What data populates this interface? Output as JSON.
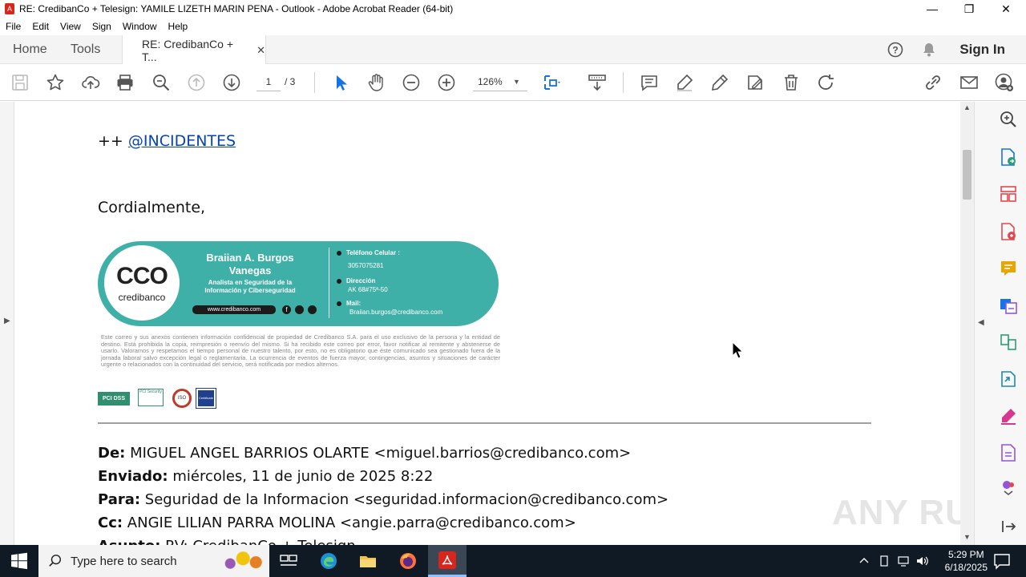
{
  "window": {
    "title": "RE: CredibanCo + Telesign: YAMILE LIZETH MARIN PENA - Outlook - Adobe Acrobat Reader (64-bit)",
    "minimize": "—",
    "maximize": "❐",
    "close": "✕"
  },
  "menu": [
    "File",
    "Edit",
    "View",
    "Sign",
    "Window",
    "Help"
  ],
  "tabs": {
    "home": "Home",
    "tools": "Tools",
    "document": "RE: CredibanCo + T...",
    "close": "✕",
    "sign_in": "Sign In"
  },
  "toolbar": {
    "page_current": "1",
    "page_total": "/ 3",
    "zoom": "126%"
  },
  "email": {
    "mention_prefix": "++",
    "mention": "@INCIDENTES",
    "closing": "Cordialmente,",
    "signature": {
      "logo": "CCO",
      "logo_sub": "credibanco",
      "name_line1": "Braiian A. Burgos",
      "name_line2": "Vanegas",
      "role_line1": "Analista en Seguridad de la",
      "role_line2": "Información y Ciberseguridad",
      "website": "www.credibanco.com",
      "phone_label": "Teléfono Celular :",
      "phone": "3057075281",
      "address_label": "Dirección",
      "address": "AK 68#75ª-50",
      "mail_label": "Mail:",
      "mail": "Braiian.burgos@credibanco.com",
      "disclaimer": "Este correo y sus anexos contienen información confidencial de propiedad de Credibanco S.A. para el uso exclusivo de la persona y la entidad de destino. Está prohibida la copia, reimpresión o reenvío del mismo. Si ha recibido este correo por error, favor notificar al remitente y abstenerse de usarlo. Valoramos y respetamos el tiempo personal de nuestro talento, por esto, no es obligatorio que éste comunicado sea gestionado fuera de la jornada laboral salvo excepción legal o reglamentaria. La ocurrencia de eventos de fuerza mayor, contingencias, asuntos y situaciones de carácter urgente o relacionados con la continuidad del servicio, será notificada por medios alternos.",
      "cert_badges": [
        "PCI DSS Certified",
        "PCI Security",
        "ISO",
        "Certificate"
      ]
    },
    "headers": [
      {
        "label": "De:",
        "value": " MIGUEL ANGEL BARRIOS OLARTE <miguel.barrios@credibanco.com>"
      },
      {
        "label": "Enviado:",
        "value": " miércoles, 11 de junio de 2025 8:22"
      },
      {
        "label": "Para:",
        "value": " Seguridad de la Informacion <seguridad.informacion@credibanco.com>"
      },
      {
        "label": "Cc:",
        "value": " ANGIE LILIAN PARRA MOLINA <angie.parra@credibanco.com>"
      },
      {
        "label": "Asunto:",
        "value": " RV: CredibanCo + Telesign"
      }
    ]
  },
  "taskbar": {
    "search_placeholder": "Type here to search",
    "time": "5:29 PM",
    "date": "6/18/2025"
  },
  "watermark": "ANY RUN",
  "colors": {
    "teal": "#3fb0a8",
    "link": "#0645ad",
    "accent_blue": "#1473e6",
    "rp_red": "#e34850",
    "rp_yellow": "#e8a600",
    "rp_green": "#2d9d78",
    "rp_purple": "#9256d9"
  }
}
